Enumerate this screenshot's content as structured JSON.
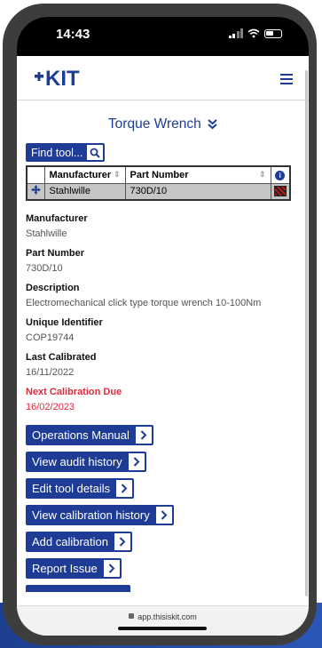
{
  "status_bar": {
    "time": "14:43"
  },
  "header": {
    "logo_text": "KIT"
  },
  "page": {
    "title": "Torque Wrench"
  },
  "find_tool": {
    "label": "Find tool..."
  },
  "table": {
    "columns": [
      "Manufacturer",
      "Part Number"
    ],
    "rows": [
      {
        "manufacturer": "Stahlwille",
        "part_number": "730D/10"
      }
    ]
  },
  "details": [
    {
      "label": "Manufacturer",
      "value": "Stahlwille"
    },
    {
      "label": "Part Number",
      "value": "730D/10"
    },
    {
      "label": "Description",
      "value": "Electromechanical click type torque wrench 10-100Nm"
    },
    {
      "label": "Unique Identifier",
      "value": "COP19744"
    },
    {
      "label": "Last Calibrated",
      "value": "16/11/2022"
    },
    {
      "label": "Next Calibration Due",
      "value": "16/02/2023"
    }
  ],
  "actions": [
    "Operations Manual",
    "View audit history",
    "Edit tool details",
    "View calibration history",
    "Add calibration",
    "Report Issue"
  ],
  "browser": {
    "url": "app.thisiskit.com"
  },
  "colors": {
    "brand": "#1e3c96",
    "alert": "#e0283c",
    "status_hatch": "#c01818"
  },
  "icons": [
    "search-icon",
    "chevron-right-icon",
    "double-chevron-down-icon",
    "hamburger-menu-icon",
    "info-icon",
    "move-icon",
    "lock-icon"
  ]
}
